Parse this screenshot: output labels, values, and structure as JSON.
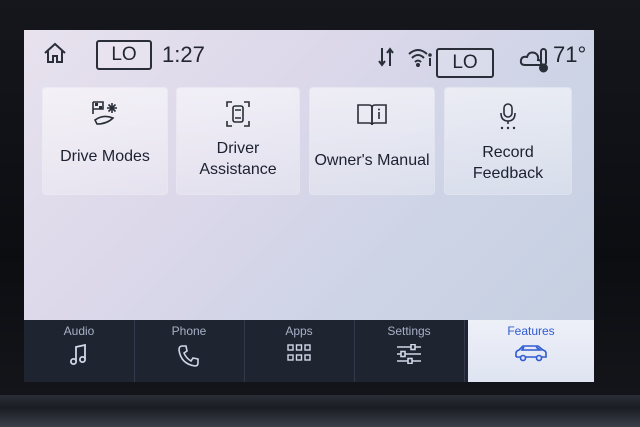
{
  "status": {
    "home_icon": "home-icon",
    "fan_level": "LO",
    "time": "1:27",
    "sync_icon": "data-sync-icon",
    "wifi_icon": "wifi-info-icon",
    "climate_level": "LO",
    "weather_icon": "cloud-thermometer-icon",
    "temperature": "71°"
  },
  "tiles": [
    {
      "label": "Drive Modes",
      "icon": "drive-modes-icon"
    },
    {
      "label": "Driver Assistance",
      "line1": "Driver",
      "line2": "Assistance",
      "icon": "driver-assist-icon"
    },
    {
      "label": "Owner's Manual",
      "icon": "manual-book-icon"
    },
    {
      "label": "Record Feedback",
      "line1": "Record",
      "line2": "Feedback",
      "icon": "microphone-icon"
    }
  ],
  "nav": [
    {
      "label": "Audio",
      "icon": "music-note-icon"
    },
    {
      "label": "Phone",
      "icon": "phone-icon"
    },
    {
      "label": "Apps",
      "icon": "apps-grid-icon"
    },
    {
      "label": "Settings",
      "icon": "sliders-icon"
    },
    {
      "label": "Features",
      "icon": "car-icon",
      "active": true
    }
  ],
  "colors": {
    "accent": "#2f5bd0",
    "navbar": "#1f2530",
    "text": "#1c2030"
  }
}
